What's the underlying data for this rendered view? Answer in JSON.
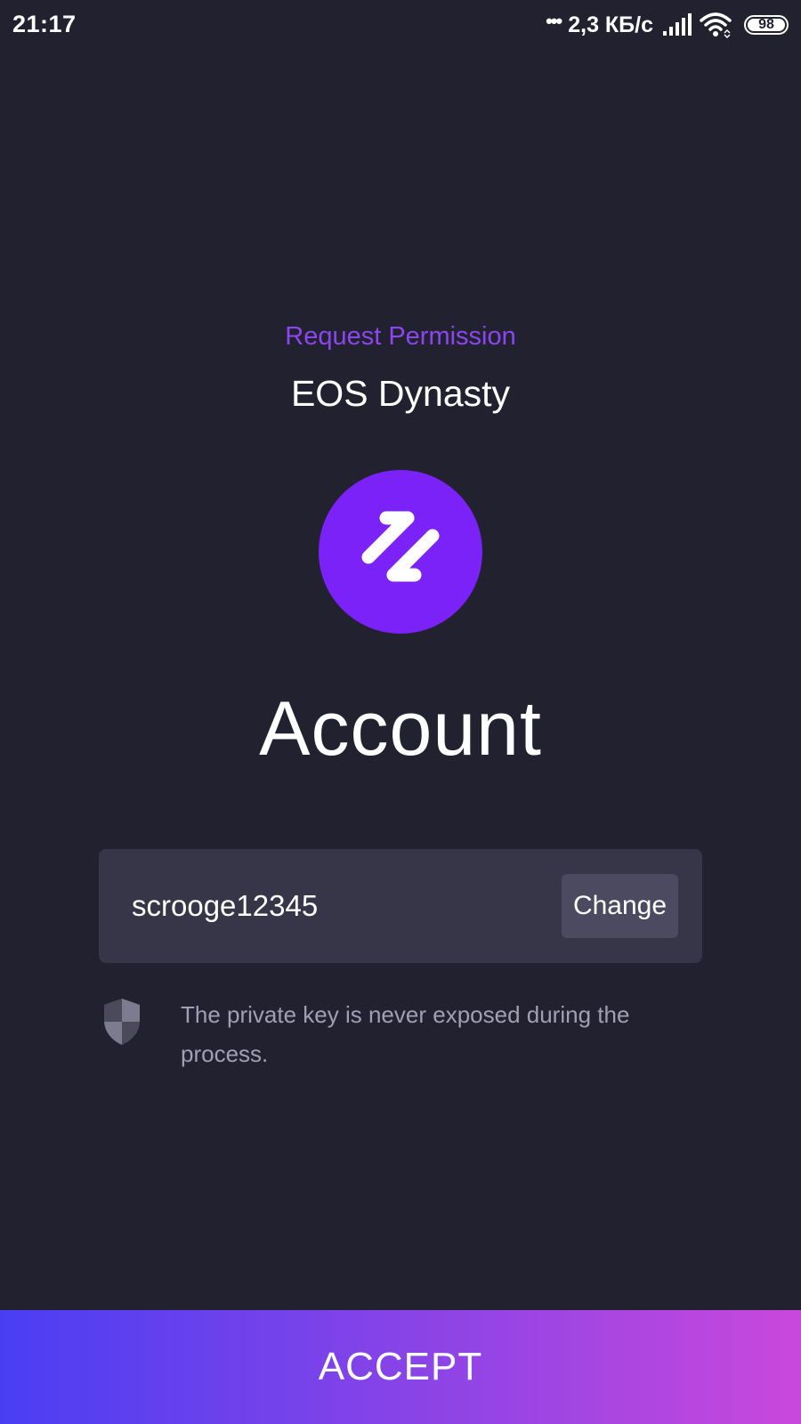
{
  "status_bar": {
    "time": "21:17",
    "dots": "•••",
    "network_speed": "2,3 КБ/с",
    "battery_level": "98",
    "icons": [
      "signal-icon",
      "wifi-icon",
      "battery-icon"
    ]
  },
  "permission": {
    "subtitle": "Request Permission",
    "dapp_name": "EOS Dynasty",
    "logo_icon": "dapp-logo-icon",
    "heading": "Account"
  },
  "account": {
    "name": "scrooge12345",
    "change_label": "Change"
  },
  "notice": {
    "icon": "shield-icon",
    "text": "The private key is never exposed during the process."
  },
  "accept_label": "ACCEPT",
  "colors": {
    "background": "#222130",
    "accent": "#8b46f0",
    "logo": "#7b22f8",
    "card": "#373649",
    "button_gradient_start": "#4a3ef3",
    "button_gradient_end": "#c948dc"
  }
}
